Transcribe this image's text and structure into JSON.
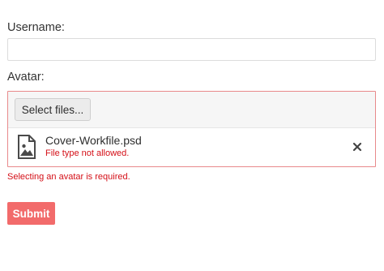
{
  "form": {
    "username_label": "Username:",
    "username_value": "",
    "username_placeholder": "",
    "avatar_label": "Avatar:",
    "select_files_label": "Select files...",
    "file": {
      "name": "Cover-Workfile.psd",
      "error": "File type not allowed.",
      "icon": "image-file-icon"
    },
    "remove_icon": "close-icon",
    "avatar_error": "Selecting an avatar is required.",
    "submit_label": "Submit"
  },
  "colors": {
    "error": "#d40f17",
    "error_border": "#e8898b",
    "submit_background": "#f26b6b"
  }
}
